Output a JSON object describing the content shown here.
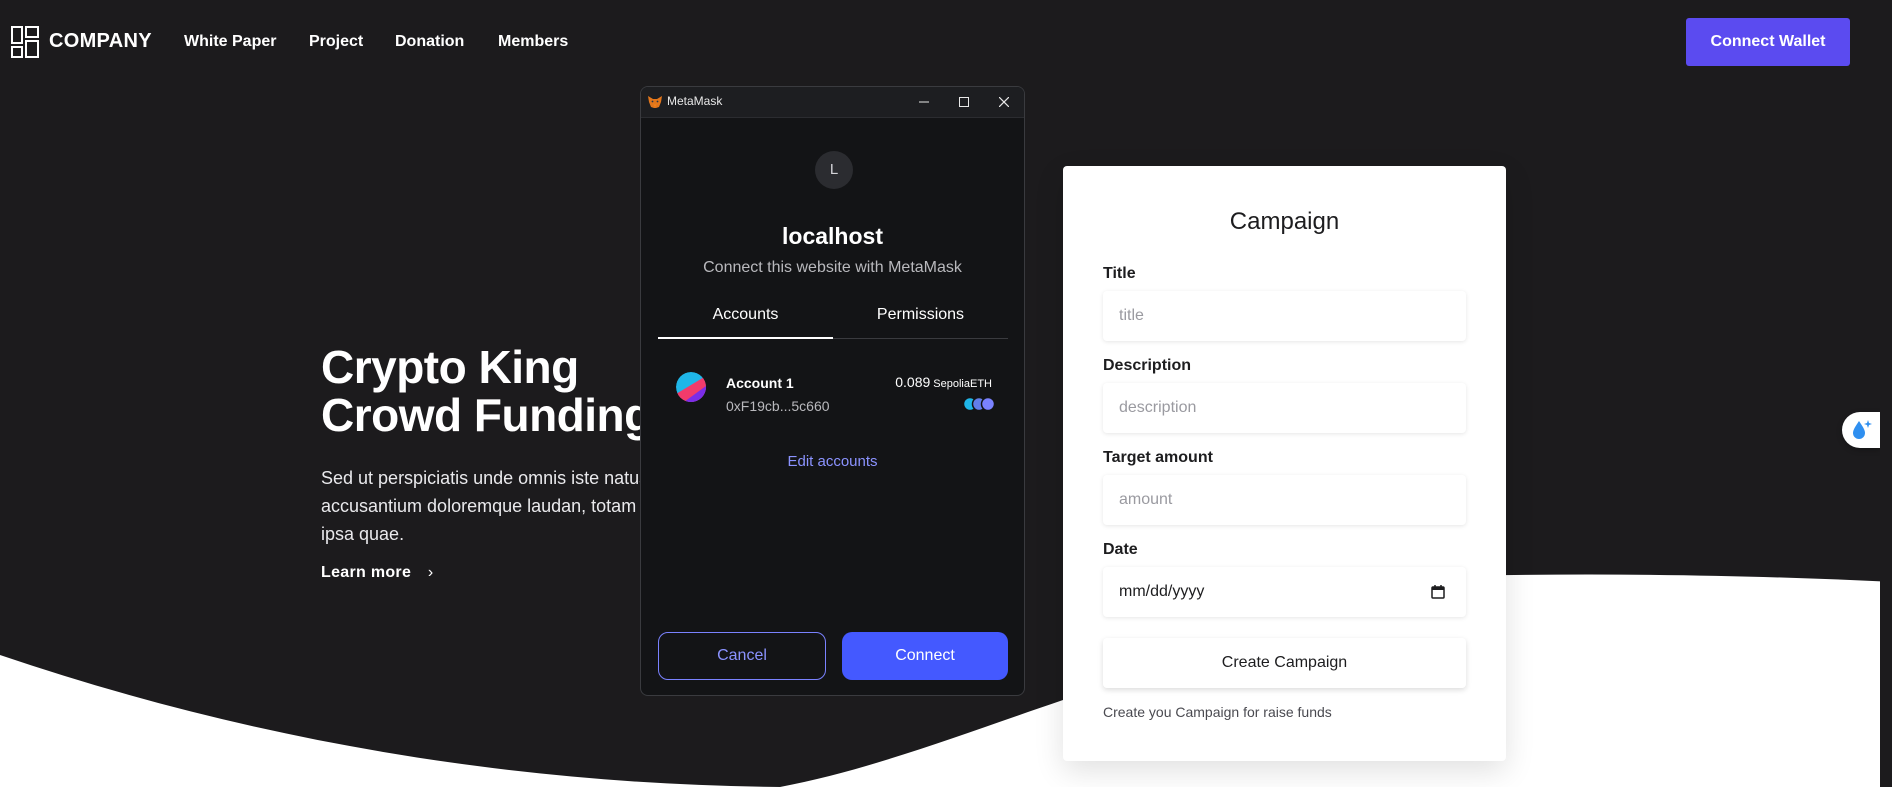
{
  "navbar": {
    "logo_text": "COMPANY",
    "links": [
      "White Paper",
      "Project",
      "Donation",
      "Members"
    ],
    "connect_wallet_label": "Connect Wallet"
  },
  "hero": {
    "title_line1": "Crypto King",
    "title_line2": "Crowd Funding",
    "description_lines": [
      "Sed ut perspiciatis unde omnis iste natus",
      "accusantium doloremque laudan, totam",
      "ipsa quae."
    ],
    "learn_more_label": "Learn more"
  },
  "campaign_form": {
    "title": "Campaign",
    "title_field": {
      "label": "Title",
      "placeholder": "title"
    },
    "description_field": {
      "label": "Description",
      "placeholder": "description"
    },
    "target_field": {
      "label": "Target amount",
      "placeholder": "amount"
    },
    "date_field": {
      "label": "Date",
      "value": "mm/dd/yyyy"
    },
    "create_button_label": "Create Campaign",
    "hint": "Create you Campaign for raise funds"
  },
  "metamask": {
    "window_title": "MetaMask",
    "site_initial": "L",
    "site_host": "localhost",
    "subtitle": "Connect this website with MetaMask",
    "tabs": [
      "Accounts",
      "Permissions"
    ],
    "active_tab": "Accounts",
    "account": {
      "name": "Account 1",
      "address": "0xF19cb...5c660",
      "balance": "0.089",
      "balance_unit": "SepoliaETH"
    },
    "edit_accounts_label": "Edit accounts",
    "cancel_label": "Cancel",
    "connect_label": "Connect"
  },
  "colors": {
    "page_background": "#1c1b1d",
    "accent": "#5b4bf0",
    "metamask_primary": "#4459ff",
    "metamask_link": "#8b93ff"
  },
  "icons": {
    "logo": "grid-logo-icon",
    "learn_more": "chevron-right-icon",
    "date_picker": "calendar-icon",
    "metamask_window": "metamask-fox-icon",
    "side_widget": "droplet-sparkle-icon"
  }
}
